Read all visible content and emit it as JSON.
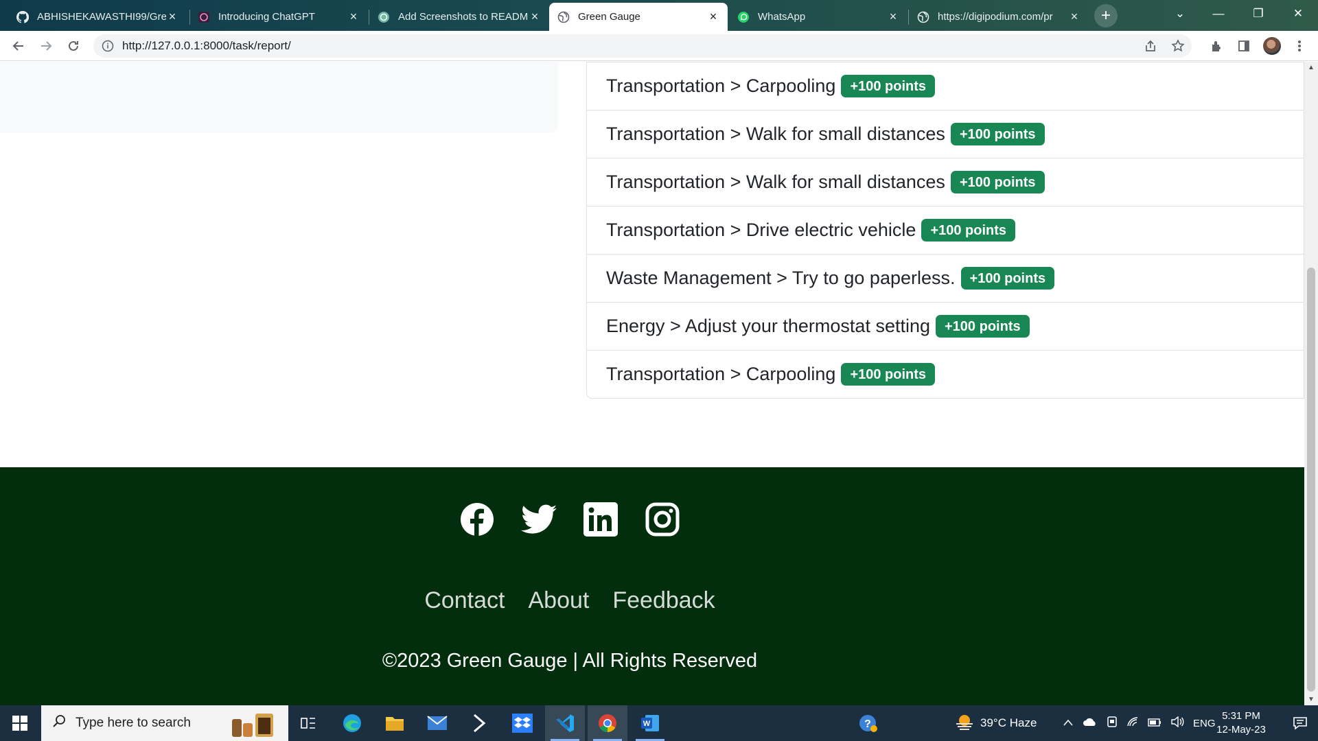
{
  "browser": {
    "tabs": [
      {
        "title": "ABHISHEKAWASTHI99/Gre",
        "icon": "github-icon",
        "active": false
      },
      {
        "title": "Introducing ChatGPT",
        "icon": "openai-icon",
        "active": false
      },
      {
        "title": "Add Screenshots to READM",
        "icon": "openai-icon",
        "active": false
      },
      {
        "title": "Green Gauge",
        "icon": "globe-icon",
        "active": true
      },
      {
        "title": "WhatsApp",
        "icon": "whatsapp-icon",
        "active": false
      },
      {
        "title": "https://digipodium.com/pr",
        "icon": "globe-icon",
        "active": false
      }
    ],
    "url": "http://127.0.0.1:8000/task/report/"
  },
  "report": {
    "items": [
      {
        "label": "Transportation > Carpooling",
        "points": "+100 points"
      },
      {
        "label": "Transportation > Walk for small distances",
        "points": "+100 points"
      },
      {
        "label": "Transportation > Walk for small distances",
        "points": "+100 points"
      },
      {
        "label": "Transportation > Drive electric vehicle",
        "points": "+100 points"
      },
      {
        "label": "Waste Management > Try to go paperless.",
        "points": "+100 points"
      },
      {
        "label": "Energy > Adjust your thermostat setting",
        "points": "+100 points"
      },
      {
        "label": "Transportation > Carpooling",
        "points": "+100 points"
      }
    ]
  },
  "footer": {
    "social": [
      "facebook-icon",
      "twitter-icon",
      "linkedin-icon",
      "instagram-icon"
    ],
    "links": {
      "contact": "Contact",
      "about": "About",
      "feedback": "Feedback"
    },
    "copyright": "©2023 Green Gauge | All Rights Reserved",
    "background": "#022e0e"
  },
  "taskbar": {
    "search_placeholder": "Type here to search",
    "weather": "39°C  Haze",
    "language": "ENG",
    "time": "5:31 PM",
    "date": "12-May-23"
  },
  "colors": {
    "badge": "#198754",
    "footer": "#022e0e"
  }
}
